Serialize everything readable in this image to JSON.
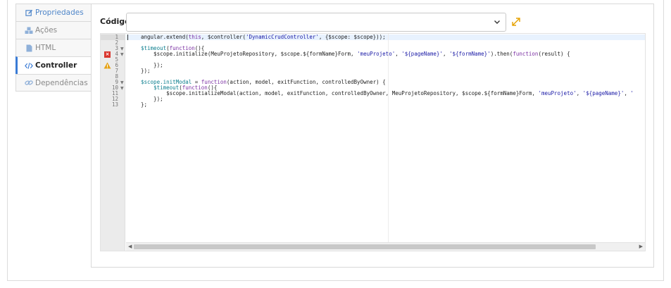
{
  "tabs": [
    {
      "label": "Propriedades",
      "icon": "edit-icon"
    },
    {
      "label": "Ações",
      "icon": "cubes-icon"
    },
    {
      "label": "HTML",
      "icon": "file-icon"
    },
    {
      "label": "Controller",
      "icon": "code-icon"
    },
    {
      "label": "Dependências",
      "icon": "link-icon"
    }
  ],
  "active_tab": "Controller",
  "colors": {
    "tab_link": "#4f86c9",
    "active_tab_border": "#3a7bd5",
    "error": "#d9352d",
    "warning": "#e6a317",
    "expand_icon": "#e5a100"
  },
  "codigo": {
    "label": "Código",
    "selected_value": ""
  },
  "editor": {
    "line_numbers": [
      "1",
      "2",
      "3",
      "4",
      "5",
      "6",
      "7",
      "8",
      "9",
      "10",
      "11",
      "12",
      "13"
    ],
    "error_line": "4",
    "warning_line": "6",
    "fold_lines": [
      "3",
      "4",
      "9",
      "10"
    ],
    "lines": [
      "angular.extend(this, $controller('DynamicCrudController', {$scope: $scope}));",
      "",
      "$timeout(function(){",
      "    $scope.initialize(MeuProjetoRepository, $scope.${formName}Form, 'meuProjeto', '${pageName}', '${formName}').then(function(result) {",
      "",
      "    });",
      "});",
      "",
      "$scope.initModal = function(action, model, exitFunction, controlledByOwner) {",
      "    $timeout(function(){",
      "        $scope.initializeModal(action, model, exitFunction, controlledByOwner, MeuProjetoRepository, $scope.${formName}Form, 'meuProjeto', '${pageName}', '",
      "    });",
      "};"
    ]
  }
}
